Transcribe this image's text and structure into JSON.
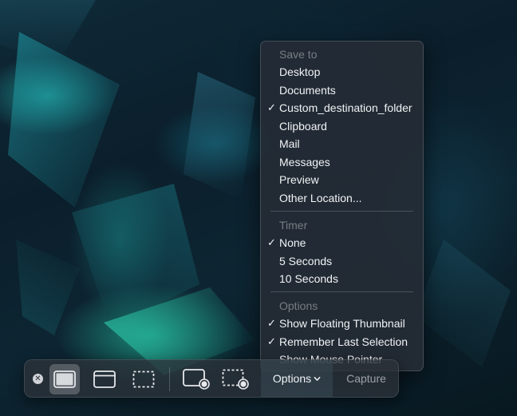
{
  "menu": {
    "save_to_header": "Save to",
    "save_to_items": [
      {
        "label": "Desktop",
        "checked": false
      },
      {
        "label": "Documents",
        "checked": false
      },
      {
        "label": "Custom_destination_folder",
        "checked": true
      },
      {
        "label": "Clipboard",
        "checked": false
      },
      {
        "label": "Mail",
        "checked": false
      },
      {
        "label": "Messages",
        "checked": false
      },
      {
        "label": "Preview",
        "checked": false
      },
      {
        "label": "Other Location...",
        "checked": false
      }
    ],
    "timer_header": "Timer",
    "timer_items": [
      {
        "label": "None",
        "checked": true
      },
      {
        "label": "5 Seconds",
        "checked": false
      },
      {
        "label": "10 Seconds",
        "checked": false
      }
    ],
    "options_header": "Options",
    "options_items": [
      {
        "label": "Show Floating Thumbnail",
        "checked": true
      },
      {
        "label": "Remember Last Selection",
        "checked": true
      },
      {
        "label": "Show Mouse Pointer",
        "checked": false
      }
    ],
    "checkmark": "✓"
  },
  "toolbar": {
    "close_glyph": "✕",
    "tools": [
      {
        "name": "capture-entire-screen",
        "selected": true
      },
      {
        "name": "capture-selected-window",
        "selected": false
      },
      {
        "name": "capture-selected-portion",
        "selected": false
      },
      {
        "name": "record-entire-screen",
        "selected": false
      },
      {
        "name": "record-selected-portion",
        "selected": false
      }
    ],
    "options_label": "Options",
    "capture_label": "Capture"
  },
  "colors": {
    "menu_bg": "#262c36",
    "toolbar_bg": "#2c323a",
    "text": "#f1f3f5",
    "header_text": "#8a8f96"
  }
}
